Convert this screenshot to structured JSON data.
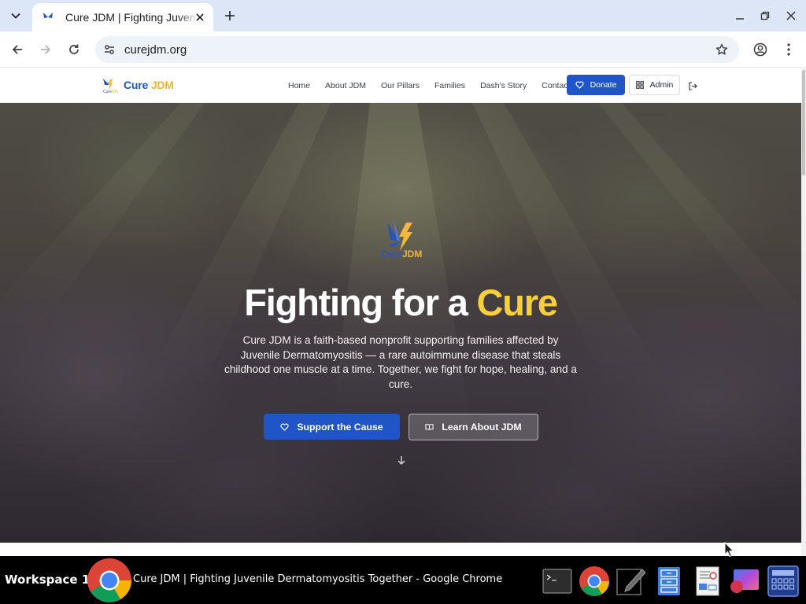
{
  "browser": {
    "tab_title": "Cure JDM | Fighting Juvenile Dermatomyositis Together",
    "url": "curejdm.org"
  },
  "site": {
    "brand_part1": "Cure",
    "brand_part2": "JDM",
    "nav": [
      "Home",
      "About JDM",
      "Our Pillars",
      "Families",
      "Dash's Story",
      "Contact"
    ],
    "donate_label": "Donate",
    "admin_label": "Admin"
  },
  "hero": {
    "logo_part1": "Cure",
    "logo_part2": "JDM",
    "title_part1": "Fighting for a",
    "title_accent": "Cure",
    "description": "Cure JDM is a faith-based nonprofit supporting families affected by Juvenile Dermatomyositis — a rare autoimmune disease that steals childhood one muscle at a time. Together, we fight for hope, healing, and a cure.",
    "support_button": "Support the Cause",
    "learn_button": "Learn About JDM"
  },
  "taskbar": {
    "workspace": "Workspace 1",
    "active_window": "Cure JDM | Fighting Juvenile Dermatomyositis Together - Google Chrome"
  },
  "colors": {
    "brand_blue": "#1f55c6",
    "brand_gold": "#e9b53a",
    "title_accent": "#f7cf3c"
  },
  "icons": {
    "tab_favicon": "butterfly-icon",
    "donate": "heart-icon",
    "admin": "grid-icon",
    "logout": "logout-icon",
    "support": "heart-icon",
    "learn": "book-icon",
    "scroll": "arrow-down-icon"
  }
}
